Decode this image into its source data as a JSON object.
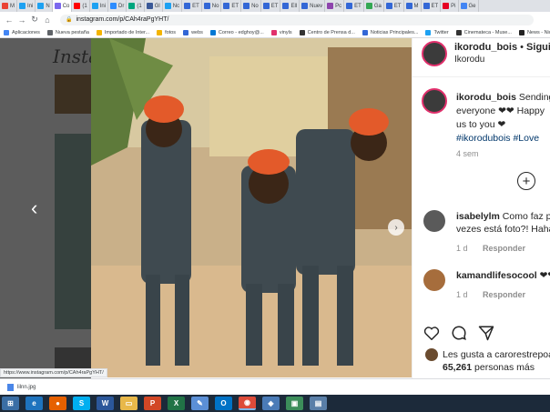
{
  "browser": {
    "tabs": [
      {
        "label": "M",
        "color": "#ea4335"
      },
      {
        "label": "Ini",
        "color": "#1da1f2"
      },
      {
        "label": "N",
        "color": "#1da1f2"
      },
      {
        "label": "Co",
        "color": "#7b68ee"
      },
      {
        "label": "(1",
        "color": "#ff0000"
      },
      {
        "label": "Ini",
        "color": "#1da1f2"
      },
      {
        "label": "Dr",
        "color": "#2d8cff"
      },
      {
        "label": "(1",
        "color": "#00a67e"
      },
      {
        "label": "Gl",
        "color": "#3b5998"
      },
      {
        "label": "Nc",
        "color": "#1da1f2"
      },
      {
        "label": "ET",
        "color": "#3367d6"
      },
      {
        "label": "No",
        "color": "#3367d6"
      },
      {
        "label": "ET",
        "color": "#3367d6"
      },
      {
        "label": "No",
        "color": "#3367d6"
      },
      {
        "label": "ET",
        "color": "#3367d6"
      },
      {
        "label": "Ell",
        "color": "#3367d6"
      },
      {
        "label": "Nuev",
        "color": "#3367d6"
      },
      {
        "label": "Pc",
        "color": "#8e44ad"
      },
      {
        "label": "ET",
        "color": "#3367d6"
      },
      {
        "label": "Ga",
        "color": "#34a853"
      },
      {
        "label": "ET",
        "color": "#3367d6"
      },
      {
        "label": "M",
        "color": "#3367d6"
      },
      {
        "label": "ET",
        "color": "#3367d6"
      },
      {
        "label": "Pi",
        "color": "#e60023"
      },
      {
        "label": "Ge",
        "color": "#4285f4"
      }
    ],
    "address": "instagram.com/p/CAh4raPgYHT/",
    "bookmarks": [
      {
        "label": "Aplicaciones",
        "color": "#4285f4"
      },
      {
        "label": "Nueva pestaña",
        "color": "#5f6368"
      },
      {
        "label": "Importado de Inter...",
        "color": "#f4b400"
      },
      {
        "label": "fotos",
        "color": "#f4b400"
      },
      {
        "label": "webs",
        "color": "#3367d6"
      },
      {
        "label": "Correo - edghoy@...",
        "color": "#0078d4"
      },
      {
        "label": "vinyls",
        "color": "#e1306c"
      },
      {
        "label": "Centro de Prensa d...",
        "color": "#333333"
      },
      {
        "label": "Noticias Principales...",
        "color": "#3367d6"
      },
      {
        "label": "Twitter",
        "color": "#1da1f2"
      },
      {
        "label": "Cinemateca - Muse...",
        "color": "#333333"
      },
      {
        "label": "News - Nicki Swift",
        "color": "#222222"
      }
    ]
  },
  "feed": {
    "logo": "Insta"
  },
  "post": {
    "username": "ikorodu_bois",
    "follow_label": "Siguien",
    "separator": "•",
    "location": "Ikorodu",
    "caption_lines": [
      "Sending",
      "everyone ❤❤ Happy",
      "us to you ❤",
      "#ikorodubois #Love"
    ],
    "time": "4 sem",
    "add_symbol": "+",
    "comments": [
      {
        "user": "isabelylm",
        "text_line1": "Como faz pr",
        "text_line2": "vezes está foto?! Hahah",
        "age": "1 d",
        "reply": "Responder"
      },
      {
        "user": "kamandlifesocool",
        "text_line1": "❤❤",
        "text_line2": "",
        "age": "1 d",
        "reply": "Responder"
      }
    ],
    "likes_line1": "Les gusta a carorestrepoa",
    "likes_count": "65,261",
    "likes_label": "personas más"
  },
  "status_url": "https://www.instagram.com/p/CAh4raPgYHT/",
  "download": {
    "filename": "lilnn.jpg"
  },
  "taskbar": {
    "icons": [
      {
        "name": "start",
        "color": "#3a6ea5",
        "glyph": "⊞"
      },
      {
        "name": "ie",
        "color": "#1e73be",
        "glyph": "e"
      },
      {
        "name": "firefox",
        "color": "#e66000",
        "glyph": "●"
      },
      {
        "name": "skype",
        "color": "#00aff0",
        "glyph": "S"
      },
      {
        "name": "word",
        "color": "#2b579a",
        "glyph": "W"
      },
      {
        "name": "explorer",
        "color": "#e8b84a",
        "glyph": "▭"
      },
      {
        "name": "powerpoint",
        "color": "#d24726",
        "glyph": "P"
      },
      {
        "name": "excel",
        "color": "#217346",
        "glyph": "X"
      },
      {
        "name": "paint",
        "color": "#5b8fd6",
        "glyph": "✎"
      },
      {
        "name": "outlook",
        "color": "#0072c6",
        "glyph": "O"
      },
      {
        "name": "chrome",
        "color": "#dd4b39",
        "glyph": "◉"
      },
      {
        "name": "shield",
        "color": "#4a7bb7",
        "glyph": "◈"
      },
      {
        "name": "image",
        "color": "#3c8d5a",
        "glyph": "▣"
      },
      {
        "name": "photos",
        "color": "#5a7fa8",
        "glyph": "▤"
      }
    ]
  }
}
